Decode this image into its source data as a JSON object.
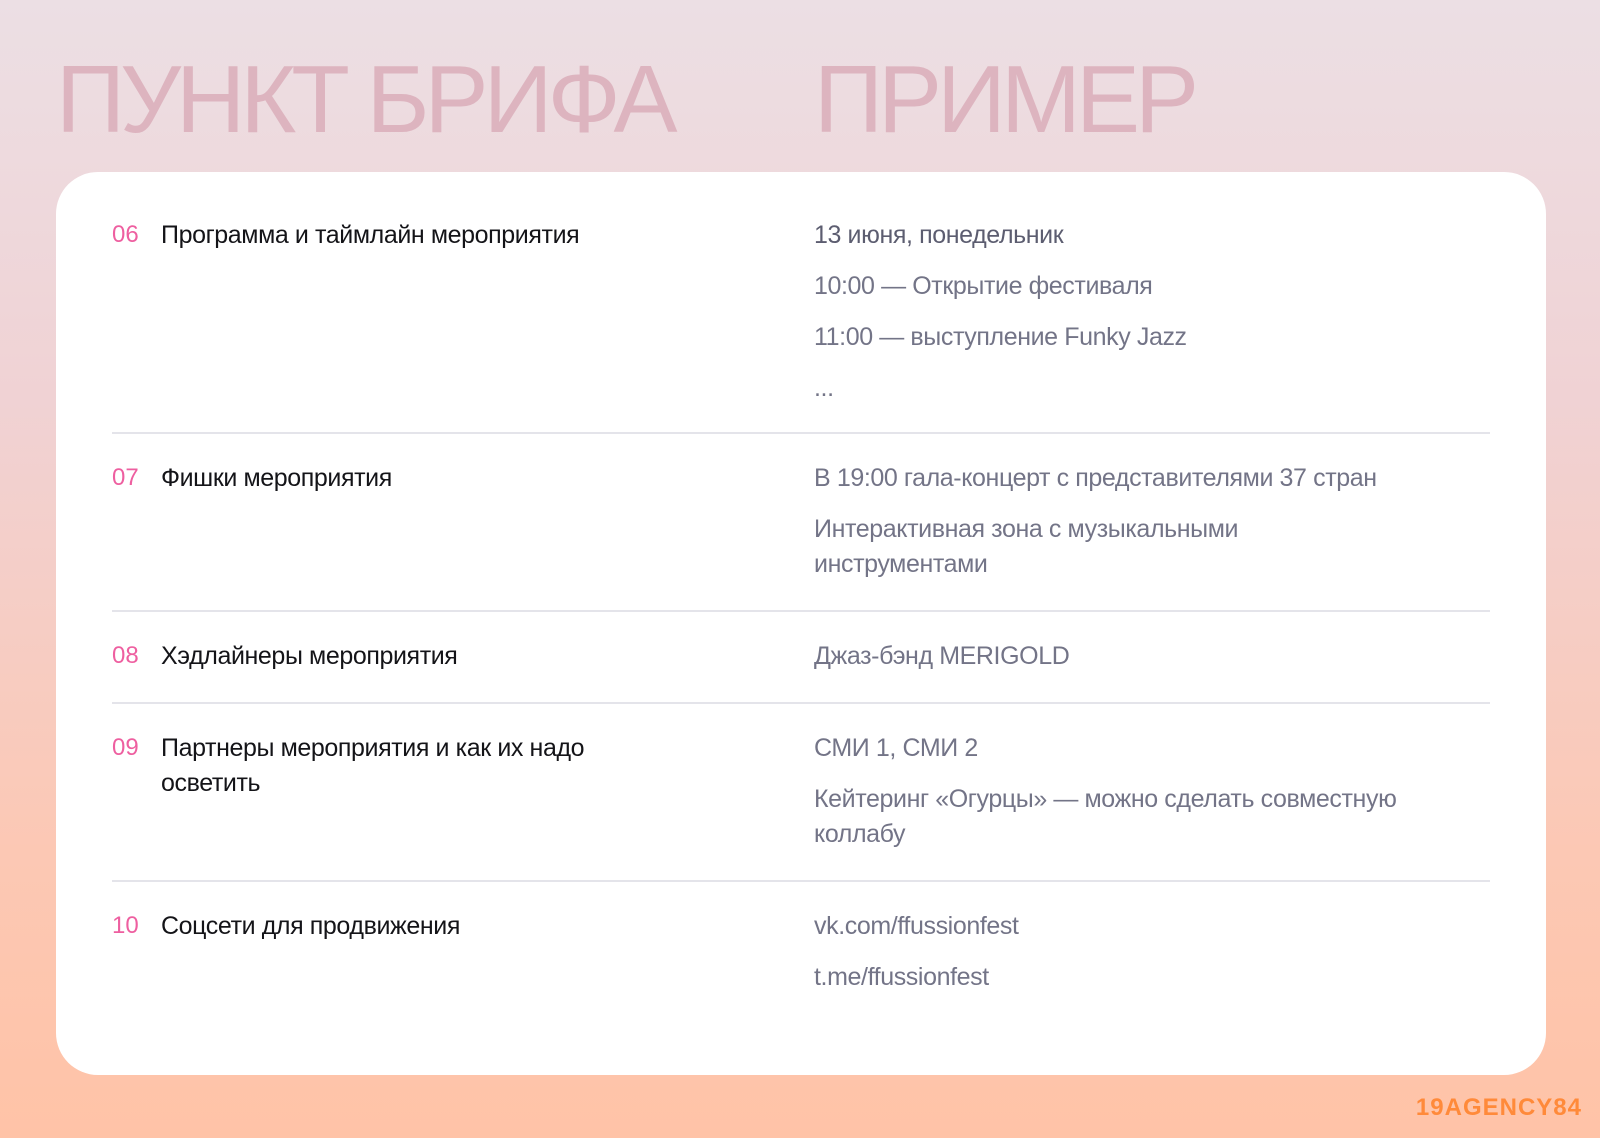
{
  "header": {
    "left_title": "ПУНКТ БРИФА",
    "right_title": "ПРИМЕР"
  },
  "rows": [
    {
      "num": "06",
      "label": "Программа и таймлайн мероприятия",
      "examples": [
        "13 июня, понедельник",
        "10:00 — Открытие фестиваля",
        "11:00 — выступление Funky Jazz",
        "..."
      ]
    },
    {
      "num": "07",
      "label": "Фишки мероприятия",
      "examples": [
        "В 19:00 гала-концерт с представителями 37 стран",
        "Интерактивная зона с музыкальными инструментами"
      ]
    },
    {
      "num": "08",
      "label": "Хэдлайнеры мероприятия",
      "examples": [
        "Джаз-бэнд MERIGOLD"
      ]
    },
    {
      "num": "09",
      "label": "Партнеры мероприятия и как их надо осветить",
      "examples": [
        "СМИ 1, СМИ 2",
        "Кейтеринг «Огурцы» — можно сделать совместную коллабу"
      ]
    },
    {
      "num": "10",
      "label": "Соцсети для продвижения",
      "examples": [
        "vk.com/ffussionfest",
        "t.me/ffussionfest"
      ]
    }
  ],
  "footer": {
    "logo": "19AGENCY84"
  },
  "colors": {
    "accent_number": "#ee5fa0",
    "header_title": "#ddb4bf",
    "logo": "#ff8a3a"
  }
}
